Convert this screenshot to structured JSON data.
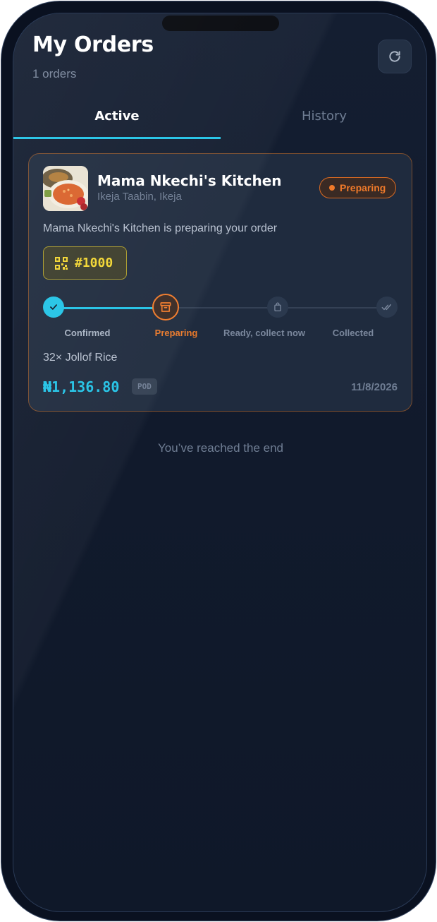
{
  "header": {
    "title": "My Orders",
    "subtitle": "1 orders",
    "refresh_icon": "refresh-icon"
  },
  "tabs": [
    {
      "label": "Active",
      "selected": true
    },
    {
      "label": "History",
      "selected": false
    }
  ],
  "order": {
    "vendor_name": "Mama Nkechi's Kitchen",
    "vendor_location": "Ikeja Taabin, Ikeja",
    "status": "Preparing",
    "status_message": "Mama Nkechi's Kitchen is preparing your order",
    "pickup_code": "#1000",
    "steps": [
      {
        "label": "Confirmed",
        "state": "done",
        "icon": "check-icon"
      },
      {
        "label": "Preparing",
        "state": "current",
        "icon": "archive-box-icon"
      },
      {
        "label": "Ready, collect now",
        "state": "pending",
        "icon": "bag-icon"
      },
      {
        "label": "Collected",
        "state": "pending",
        "icon": "double-check-icon"
      }
    ],
    "items": "32× Jollof Rice",
    "price": "₦1,136.80",
    "payment_method": "POD",
    "date": "11/8/2026"
  },
  "footer": {
    "end_message": "You’ve reached the end"
  },
  "colors": {
    "accent": "#22c3e6",
    "status_orange": "#f07a2a",
    "code_yellow": "#f2d531",
    "background": "#111a2c"
  }
}
